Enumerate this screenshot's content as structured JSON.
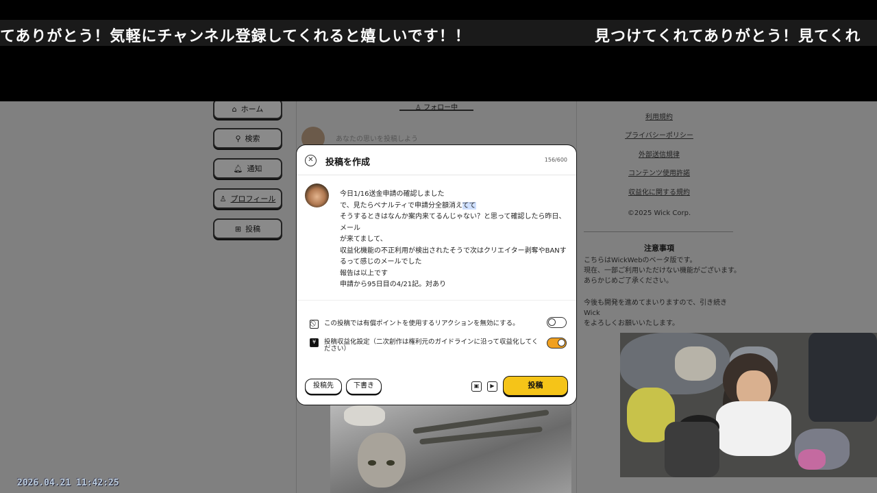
{
  "overlay": {
    "ticker_left": "てありがとう！気軽にチャンネル登録してくれると嬉しいです！！",
    "ticker_right": "見つけてくれてありがとう！見てくれ",
    "timestamp": "2026.04.21 11:42:25"
  },
  "nav": {
    "home": "ホーム",
    "search": "検索",
    "notifications": "通知",
    "profile": "プロフィール",
    "post": "投稿"
  },
  "feed": {
    "follow_tab": "フォロー中",
    "compose_placeholder": "あなたの思いを投稿しよう"
  },
  "right": {
    "links": [
      "利用規約",
      "プライバシーポリシー",
      "外部送信規律",
      "コンテンツ使用許諾",
      "収益化に関する規約"
    ],
    "copyright": "©2025 Wick Corp.",
    "notice_title": "注意事項",
    "notice_lines_1": [
      "こちらはWickWebのベータ版です。",
      "現在、一部ご利用いただけない機能がございます。",
      "あらかじめご了承ください。"
    ],
    "notice_lines_2": [
      "今後も開発を進めてまいりますので、引き続きWick",
      "をよろしくお願いいたします。"
    ]
  },
  "modal": {
    "title": "投稿を作成",
    "char_count": "156/600",
    "body_line1": "今日1/16送金申請の確認しました",
    "body_line2_a": "で、見たらペナルティで申請分全額消え",
    "body_line2_b": "てて",
    "body_line3": "そうするときはなんか案内来てるんじゃない？と思って確認したら昨日、メール",
    "body_line4": "が来てまして、",
    "body_line5": "収益化機能の不正利用が検出されたそうで次はクリエイター剥奪やBANす",
    "body_line6": "るって感じのメールでした",
    "body_line7": "報告は以上です",
    "body_line8": "申請から95日目の4/21記。対あり",
    "option1": "この投稿では有償ポイントを使用するリアクションを無効にする。",
    "option1_on": false,
    "option2": "投稿収益化設定（二次創作は権利元のガイドラインに沿って収益化してください）",
    "option2_on": true,
    "dest_button": "投稿先",
    "draft_button": "下書き",
    "post_button": "投稿"
  },
  "colors": {
    "post_button": "#f5c418",
    "toggle_on": "#f0a020",
    "highlight": "#cfe0ff"
  }
}
